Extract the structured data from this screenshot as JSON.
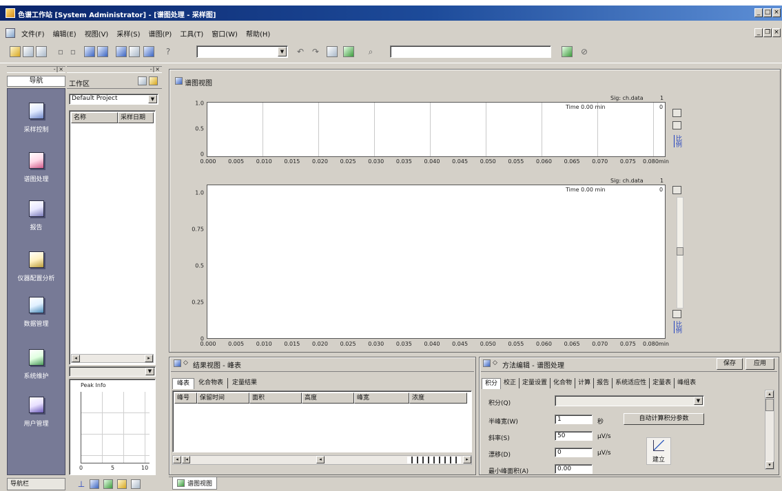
{
  "window": {
    "title": "色谱工作站 [System Administrator] - [谱图处理 - 采样图]",
    "minimize": "_",
    "maximize": "□",
    "close": "×"
  },
  "menu": {
    "items": [
      "文件(F)",
      "编辑(E)",
      "视图(V)",
      "采样(S)",
      "谱图(P)",
      "工具(T)",
      "窗口(W)",
      "帮助(H)"
    ],
    "mdi_minimize": "_",
    "mdi_restore": "❐",
    "mdi_close": "×"
  },
  "toolbar": {
    "method_combo": "",
    "path_field": "",
    "icons": [
      "new-icon",
      "open-icon",
      "save-icon",
      "print-icon",
      "preview-icon",
      "layout-icon",
      "split-icon",
      "tile-icon",
      "grid-icon",
      "chart-icon",
      "help-icon",
      "undo-icon",
      "redo-icon",
      "copy-icon",
      "paste-icon",
      "find-icon",
      "zoom-in-icon",
      "zoom-out-icon"
    ]
  },
  "nav": {
    "header": "导航",
    "items": [
      {
        "label": "采样控制",
        "icon": "sampling-icon"
      },
      {
        "label": "谱图处理",
        "icon": "chromatogram-icon"
      },
      {
        "label": "报告",
        "icon": "report-icon"
      },
      {
        "label": "仪器配置分析",
        "icon": "instrument-icon"
      },
      {
        "label": "数据管理",
        "icon": "data-icon"
      },
      {
        "label": "系统维护",
        "icon": "maintenance-icon"
      },
      {
        "label": "用户管理",
        "icon": "user-icon"
      }
    ],
    "footer": "导航栏",
    "background": "#777a96"
  },
  "workspace": {
    "title": "工作区",
    "project": "Default Project",
    "columns": [
      "名称",
      "采样日期"
    ],
    "preview_title": "Peak Info",
    "preview_ticks": [
      "0",
      "5",
      "10"
    ]
  },
  "chart_view": {
    "title": "谱图视图",
    "signal": "Sig: ch.data",
    "channel": "1",
    "time_label": "Time  0.00  min",
    "zero": "0",
    "zoom_label": "比例",
    "top_y_ticks": [
      "1.0",
      "0.5",
      "0"
    ],
    "bottom_y_ticks": [
      "1.0",
      "0.75",
      "0.5",
      "0.25",
      "0"
    ],
    "x_ticks": [
      "0.000",
      "0.005",
      "0.010",
      "0.015",
      "0.020",
      "0.025",
      "0.030",
      "0.035",
      "0.040",
      "0.045",
      "0.050",
      "0.055",
      "0.060",
      "0.065",
      "0.070",
      "0.075",
      "0.080min"
    ]
  },
  "result_panel": {
    "title": "结果视图 - 峰表",
    "tabs": [
      "峰表",
      "化合物表",
      "定量结果"
    ],
    "columns": [
      "峰号",
      "保留时间",
      "面积",
      "高度",
      "峰宽",
      "浓度"
    ]
  },
  "method_panel": {
    "title": "方法编辑 - 谱图处理",
    "save": "保存",
    "apply": "应用",
    "tabs": [
      "积分",
      "校正",
      "定量设置",
      "化合物",
      "计算",
      "报告",
      "系统适应性",
      "定量表",
      "峰组表"
    ],
    "fields": {
      "method_label": "积分(Q)",
      "method_value": "",
      "width_label": "半峰宽(W)",
      "width_value": "1",
      "width_unit": "秒",
      "slope_label": "斜率(S)",
      "slope_value": "50",
      "slope_unit": "μV/s",
      "drift_label": "漂移(D)",
      "drift_value": "0",
      "drift_unit": "μV/s",
      "min_area_label": "最小峰面积(A)",
      "min_area_value": "0.00"
    },
    "auto_button": "自动计算积分参数",
    "build_button": "建立"
  },
  "doc_tab": "谱图视图"
}
